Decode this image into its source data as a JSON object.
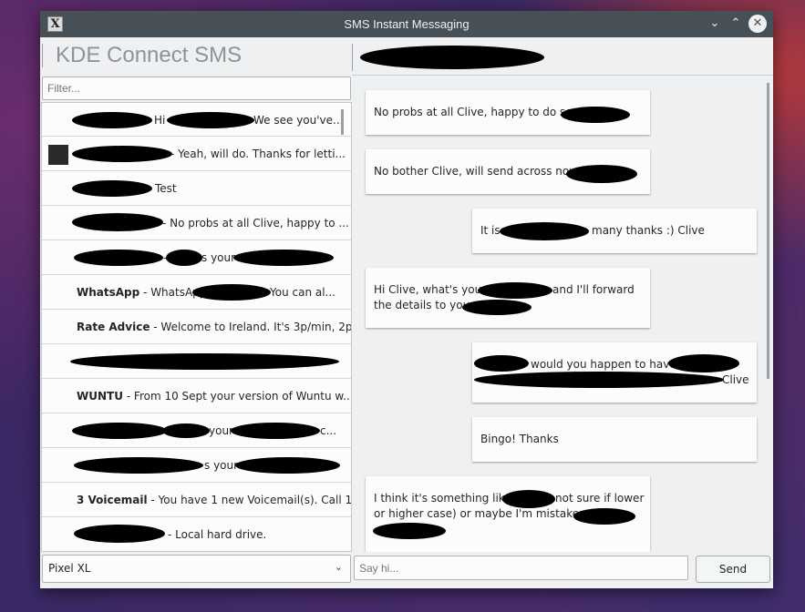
{
  "window": {
    "title": "SMS Instant Messaging",
    "app_icon": "x-app-icon",
    "controls": [
      "minimize-icon",
      "maximize-icon",
      "close-icon"
    ]
  },
  "header": {
    "app_name": "KDE Connect SMS"
  },
  "filter": {
    "placeholder": "Filter..."
  },
  "conversations": [
    {
      "name": "",
      "preview": "Hi",
      "preview2": "We see you've..."
    },
    {
      "name": "",
      "preview": "- Yeah, will do. Thanks for letti..."
    },
    {
      "name": "",
      "preview": "Test"
    },
    {
      "name": "",
      "preview": "- No probs at all Clive, happy to ..."
    },
    {
      "name": "",
      "preview": "- ",
      "preview2": "s your"
    },
    {
      "name": "WhatsApp",
      "preview": " - WhatsApp",
      "preview2": "You can al..."
    },
    {
      "name": "Rate Advice",
      "preview": " - Welcome to Ireland. It's 3p/min, 2p..."
    },
    {
      "name": "",
      "preview": ""
    },
    {
      "name": "WUNTU",
      "preview": " - From 10 Sept your version of Wuntu w..."
    },
    {
      "name": "",
      "preview": "your",
      "preview2": "c..."
    },
    {
      "name": "",
      "preview": "s your"
    },
    {
      "name": "3 Voicemail",
      "preview": " - You have 1 new Voicemail(s). Call 1..."
    },
    {
      "name": "",
      "preview": "- Local hard drive."
    }
  ],
  "messages": [
    {
      "text": "No probs at all Clive, happy to do so.",
      "direction": "outgoing"
    },
    {
      "text": "No bother Clive, will send across now.",
      "direction": "outgoing"
    },
    {
      "text": "It is",
      "text2": "many thanks :) Clive",
      "direction": "incoming"
    },
    {
      "text": "Hi Clive, what's your",
      "text2": "and I'll forward",
      "text3": "the details to you",
      "direction": "outgoing"
    },
    {
      "text": "would you happen to have",
      "text2": "Clive",
      "direction": "incoming"
    },
    {
      "text": "Bingo! Thanks",
      "direction": "incoming"
    },
    {
      "text": "I think it's something like",
      "text2": "not sure if lower",
      "text3": "or higher case) or maybe I'm mistaken.",
      "direction": "outgoing"
    }
  ],
  "device_select": {
    "value": "Pixel XL"
  },
  "compose": {
    "placeholder": "Say hi...",
    "send_label": "Send"
  }
}
